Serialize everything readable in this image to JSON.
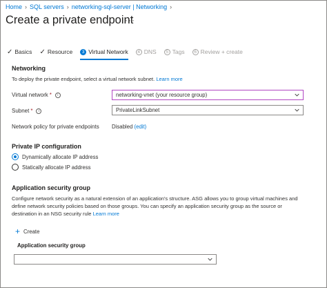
{
  "breadcrumb": [
    "Home",
    "SQL servers",
    "networking-sql-server | Networking"
  ],
  "page_title": "Create a private endpoint",
  "title_more": "···",
  "tabs": [
    {
      "label": "Basics",
      "state": "completed"
    },
    {
      "label": "Resource",
      "state": "completed"
    },
    {
      "number": "3",
      "label": "Virtual Network",
      "state": "active"
    },
    {
      "number": "4",
      "label": "DNS",
      "state": "disabled"
    },
    {
      "number": "5",
      "label": "Tags",
      "state": "disabled"
    },
    {
      "number": "6",
      "label": "Review + create",
      "state": "disabled"
    }
  ],
  "networking": {
    "heading": "Networking",
    "description": "To deploy the private endpoint, select a virtual network subnet.",
    "learn_more": "Learn more",
    "vnet_label": "Virtual network",
    "vnet_value": "networking-vnet (your resource group)",
    "subnet_label": "Subnet",
    "subnet_value": "PrivateLinkSubnet",
    "policy_label": "Network policy for private endpoints",
    "policy_value": "Disabled",
    "policy_edit": "(edit)"
  },
  "private_ip": {
    "heading": "Private IP configuration",
    "options": [
      "Dynamically allocate IP address",
      "Statically allocate IP address"
    ],
    "selected": 0
  },
  "asg": {
    "heading": "Application security group",
    "description_lines": [
      "Configure network security as a natural extension of an application's structure. ASG allows you to group virtual machines and",
      "define network security policies based on those groups. You can specify an application security group as the source or",
      "destination in an NSG security rule"
    ],
    "learn_more": "Learn more",
    "create_label": "Create",
    "column_header": "Application security group",
    "select_value": ""
  },
  "colors": {
    "accent": "#0078d4",
    "focus_border": "#b146c2",
    "required": "#a4262c"
  }
}
